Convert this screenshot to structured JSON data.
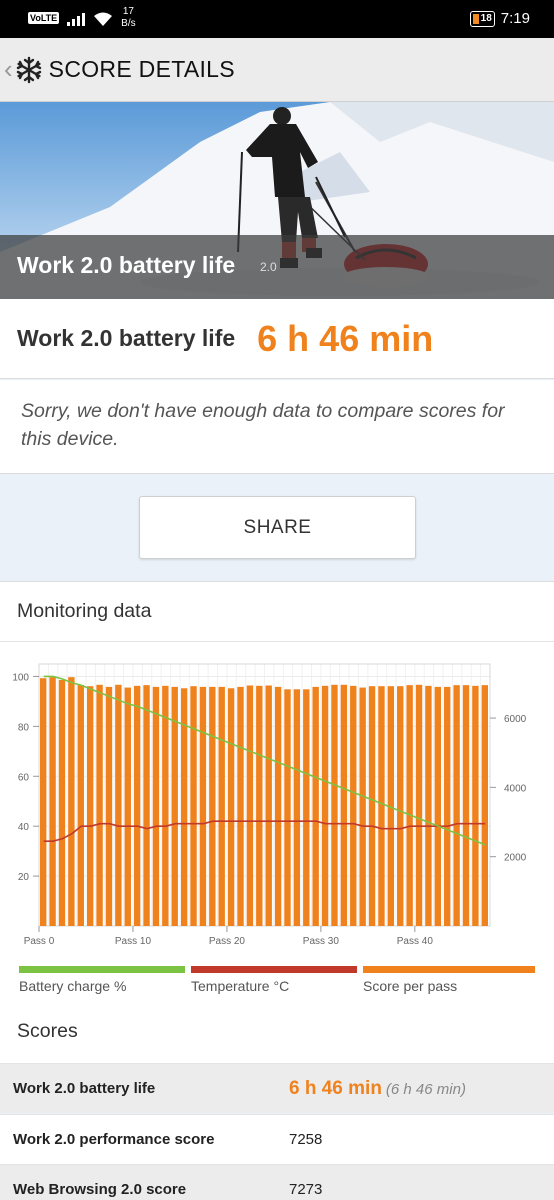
{
  "status_bar": {
    "volte": "VoLTE",
    "net_speed_value": "17",
    "net_speed_unit": "B/s",
    "battery": "18",
    "time": "7:19"
  },
  "app_bar": {
    "back_icon": "chevron-left-icon",
    "logo_icon": "snowflake-icon",
    "title": "SCORE DETAILS"
  },
  "hero": {
    "label": "Work 2.0 battery life",
    "version": "2.0"
  },
  "result": {
    "label": "Work 2.0 battery life",
    "value": "6 h 46 min"
  },
  "notice": "Sorry, we don't have enough data to compare scores for this device.",
  "share_label": "SHARE",
  "monitoring": {
    "title": "Monitoring data",
    "legend": [
      {
        "label": "Battery charge %",
        "color": "#7cc243"
      },
      {
        "label": "Temperature °C",
        "color": "#c0392b"
      },
      {
        "label": "Score per pass",
        "color": "#f0821e"
      }
    ]
  },
  "chart_data": {
    "type": "bar",
    "x_ticks": [
      "Pass 0",
      "Pass 10",
      "Pass 20",
      "Pass 30",
      "Pass 40"
    ],
    "y_left_ticks": [
      "100",
      "80",
      "60",
      "40",
      "20"
    ],
    "y_left_range": [
      0,
      105
    ],
    "y_right_ticks": [
      "6000",
      "4000",
      "2000"
    ],
    "y_right_range": [
      0,
      7560
    ],
    "series": [
      {
        "name": "Score per pass",
        "axis": "right",
        "values": [
          7150,
          7180,
          7100,
          7180,
          6950,
          6920,
          6960,
          6900,
          6960,
          6880,
          6930,
          6950,
          6900,
          6930,
          6900,
          6860,
          6920,
          6900,
          6900,
          6900,
          6860,
          6900,
          6940,
          6930,
          6940,
          6900,
          6830,
          6830,
          6830,
          6900,
          6930,
          6960,
          6960,
          6930,
          6880,
          6920,
          6920,
          6920,
          6920,
          6950,
          6960,
          6930,
          6900,
          6900,
          6950,
          6950,
          6930,
          6950
        ]
      },
      {
        "name": "Battery charge %",
        "axis": "left",
        "values": [
          100,
          100,
          99,
          97.5,
          96.5,
          95,
          93.5,
          92,
          90.5,
          89,
          88,
          86.5,
          85,
          83.5,
          82,
          80.5,
          79,
          77.5,
          76,
          74.5,
          73,
          71.5,
          70,
          68.5,
          67,
          65.5,
          64,
          62.5,
          61,
          59.5,
          58,
          56.5,
          55,
          53.5,
          52,
          50.5,
          49,
          47.5,
          46,
          44.5,
          43,
          41.5,
          40,
          38.5,
          37,
          35.5,
          34,
          32.5
        ]
      },
      {
        "name": "Temperature °C",
        "axis": "left",
        "values": [
          34,
          34,
          35,
          37,
          40,
          40,
          41,
          41,
          40,
          40,
          40,
          39,
          40,
          40,
          41,
          41,
          41,
          41,
          42,
          42,
          42,
          42,
          42,
          42,
          42,
          42,
          42,
          42,
          42,
          42,
          41,
          41,
          41,
          41,
          40,
          40,
          39,
          39,
          39,
          40,
          40,
          40,
          40,
          40,
          41,
          41,
          41,
          41
        ]
      }
    ]
  },
  "scores": {
    "title": "Scores",
    "rows": [
      {
        "name": "Work 2.0 battery life",
        "value": "6 h 46 min",
        "sub": "(6 h 46 min)"
      },
      {
        "name": "Work 2.0 performance score",
        "value": "7258"
      },
      {
        "name": "Web Browsing 2.0 score",
        "value": "7273"
      }
    ]
  }
}
